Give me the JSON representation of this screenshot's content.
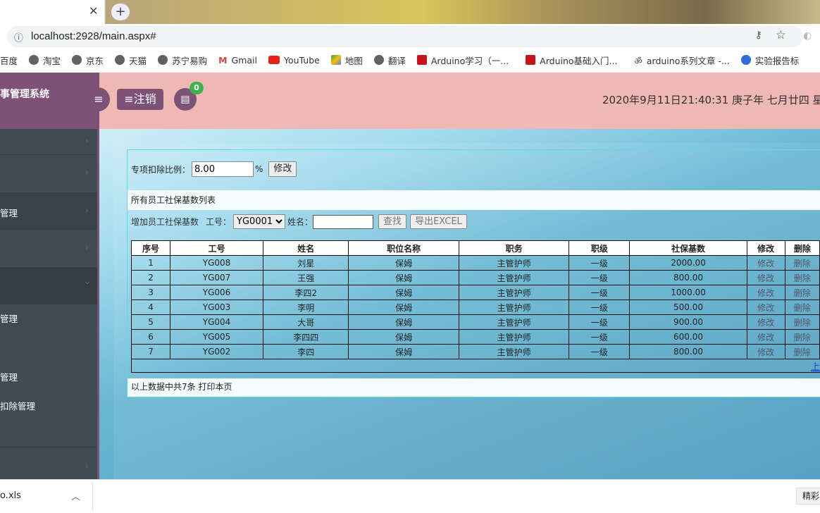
{
  "browser": {
    "url": "localhost:2928/main.aspx#",
    "bookmarks": [
      "百度",
      "淘宝",
      "京东",
      "天猫",
      "苏宁易购",
      "Gmail",
      "YouTube",
      "地图",
      "翻译",
      "Arduino学习（一...",
      "Arduino基础入门...",
      "arduino系列文章 -...",
      "实验报告标"
    ],
    "download_file": "o.xls",
    "right_button": "精彩"
  },
  "header": {
    "title": "事管理系统",
    "logout_label": "注销",
    "message_count": "0",
    "clock": "2020年9月11日21:40:31 庚子年 七月廿四 星",
    "brand_color": "#7e5277",
    "header_color": "#efb8b4"
  },
  "sidebar": {
    "items": [
      "",
      "",
      "管理",
      "",
      "",
      "管理",
      "",
      "管理",
      "扣除管理",
      ""
    ]
  },
  "main": {
    "rate_label": "专项扣除比例：",
    "rate_value": "8.00",
    "rate_unit": "%",
    "modify_label": "修改",
    "list_title": "所有员工社保基数列表",
    "add_label": "增加员工社保基数",
    "emp_id_label": "工号：",
    "emp_id_selected": "YG0001",
    "name_label": "姓名：",
    "name_value": "",
    "search_label": "查找",
    "export_label": "导出EXCEL",
    "columns": [
      "序号",
      "工号",
      "姓名",
      "职位名称",
      "职务",
      "职级",
      "社保基数",
      "修改",
      "删除"
    ],
    "rows": [
      [
        "1",
        "YG008",
        "刘星",
        "保姆",
        "主管护师",
        "一级",
        "2000.00",
        "修改",
        "删除"
      ],
      [
        "2",
        "YG007",
        "王强",
        "保姆",
        "主管护师",
        "一级",
        "800.00",
        "修改",
        "删除"
      ],
      [
        "3",
        "YG006",
        "李四2",
        "保姆",
        "主管护师",
        "一级",
        "1000.00",
        "修改",
        "删除"
      ],
      [
        "4",
        "YG003",
        "李明",
        "保姆",
        "主管护师",
        "一级",
        "500.00",
        "修改",
        "删除"
      ],
      [
        "5",
        "YG004",
        "大哥",
        "保姆",
        "主管护师",
        "一级",
        "900.00",
        "修改",
        "删除"
      ],
      [
        "6",
        "YG005",
        "李四四",
        "保姆",
        "主管护师",
        "一级",
        "600.00",
        "修改",
        "删除"
      ],
      [
        "7",
        "YG002",
        "李四",
        "保姆",
        "主管护师",
        "一级",
        "800.00",
        "修改",
        "删除"
      ]
    ],
    "pager_label": "上",
    "footer_text": "以上数据中共7条 打印本页"
  }
}
